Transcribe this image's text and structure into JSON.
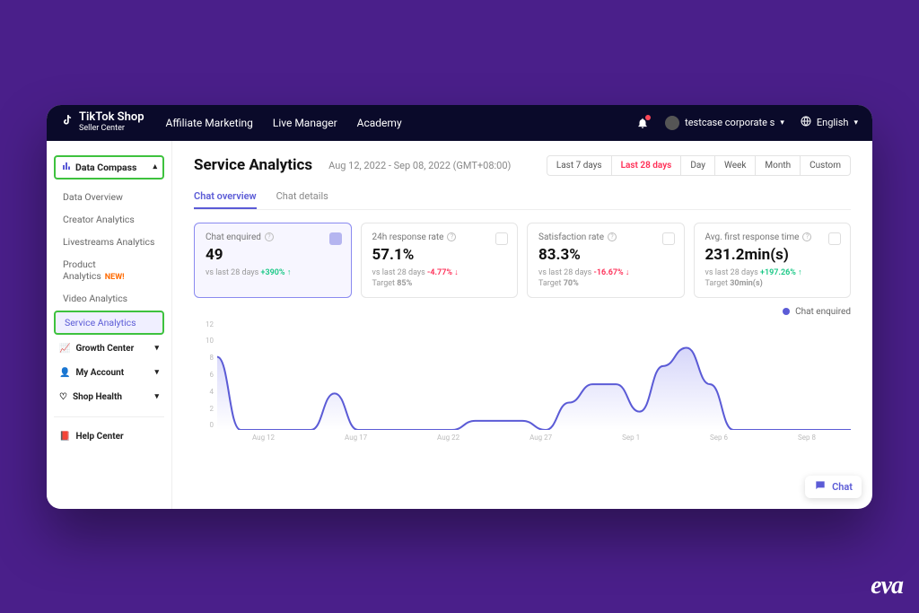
{
  "brand": {
    "line1": "TikTok Shop",
    "line2": "Seller Center"
  },
  "topnav": {
    "affiliate": "Affiliate Marketing",
    "live": "Live Manager",
    "academy": "Academy"
  },
  "user": {
    "name": "testcase corporate s"
  },
  "language": {
    "label": "English"
  },
  "sidebar": {
    "compass_label": "Data Compass",
    "items": {
      "overview": "Data Overview",
      "creator": "Creator Analytics",
      "livestreams": "Livestreams Analytics",
      "product": "Product Analytics",
      "product_new": "NEW!",
      "video": "Video Analytics",
      "service": "Service Analytics"
    },
    "growth": "Growth Center",
    "account": "My Account",
    "shop_health": "Shop Health",
    "help": "Help Center"
  },
  "page": {
    "title": "Service Analytics",
    "date_range": "Aug 12, 2022 - Sep 08, 2022 (GMT+08:00)"
  },
  "ranges": {
    "last7": "Last 7 days",
    "last28": "Last 28 days",
    "day": "Day",
    "week": "Week",
    "month": "Month",
    "custom": "Custom"
  },
  "tabs": {
    "overview": "Chat overview",
    "details": "Chat details"
  },
  "cards": {
    "chat_enquired": {
      "title": "Chat enquired",
      "value": "49",
      "sub_prefix": "vs last 28 days ",
      "delta": "+390%",
      "arrow": "↑"
    },
    "response_rate": {
      "title": "24h response rate",
      "value": "57.1%",
      "sub_prefix": "vs last 28 days ",
      "delta": "-4.77%",
      "arrow": "↓",
      "target_label": "Target ",
      "target": "85%"
    },
    "satisfaction": {
      "title": "Satisfaction rate",
      "value": "83.3%",
      "sub_prefix": "vs last 28 days ",
      "delta": "-16.67%",
      "arrow": "↓",
      "target_label": "Target ",
      "target": "70%"
    },
    "first_response": {
      "title": "Avg. first response time",
      "value": "231.2min(s)",
      "sub_prefix": "vs last 28 days ",
      "delta": "+197.26%",
      "arrow": "↑",
      "target_label": "Target ",
      "target": "30min(s)"
    }
  },
  "legend": {
    "chat_enquired": "Chat enquired"
  },
  "chart_data": {
    "type": "line",
    "title": "Chat enquired",
    "ylabel": "",
    "xlabel": "",
    "ylim": [
      0,
      12
    ],
    "x_ticks": [
      "Aug 12",
      "Aug 17",
      "Aug 22",
      "Aug 27",
      "Sep 1",
      "Sep 6",
      "Sep 8"
    ],
    "y_ticks": [
      0,
      2,
      4,
      6,
      8,
      10,
      12
    ],
    "x": [
      "Aug 12",
      "Aug 13",
      "Aug 14",
      "Aug 15",
      "Aug 16",
      "Aug 17",
      "Aug 18",
      "Aug 19",
      "Aug 20",
      "Aug 21",
      "Aug 22",
      "Aug 23",
      "Aug 24",
      "Aug 25",
      "Aug 26",
      "Aug 27",
      "Aug 28",
      "Aug 29",
      "Aug 30",
      "Aug 31",
      "Sep 1",
      "Sep 2",
      "Sep 3",
      "Sep 4",
      "Sep 5",
      "Sep 6",
      "Sep 7",
      "Sep 8"
    ],
    "series": [
      {
        "name": "Chat enquired",
        "values": [
          8,
          0,
          0,
          0,
          0,
          4,
          0,
          0,
          0,
          0,
          0,
          1,
          1,
          1,
          0,
          3,
          5,
          5,
          2,
          7,
          9,
          5,
          0,
          0,
          0,
          0,
          0,
          0
        ]
      }
    ]
  },
  "chat_float": "Chat",
  "footer_logo": "eva"
}
